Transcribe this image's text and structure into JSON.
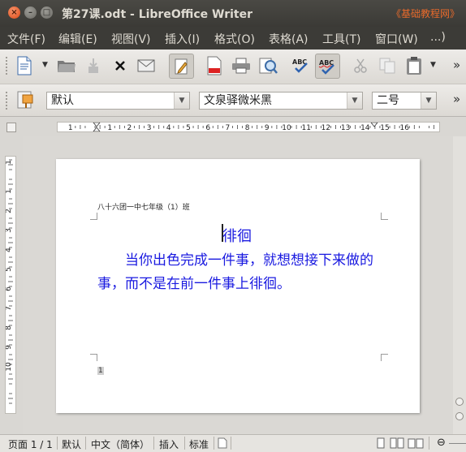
{
  "window": {
    "title": "第27课.odt - LibreOffice Writer",
    "watermark": "《基础教程网》",
    "close_glyph": "×",
    "min_glyph": "–",
    "max_glyph": "□"
  },
  "menu": [
    "文件(F)",
    "编辑(E)",
    "视图(V)",
    "插入(I)",
    "格式(O)",
    "表格(A)",
    "工具(T)",
    "窗口(W)",
    "...)"
  ],
  "toolbar": {
    "buttons": [
      "new-document",
      "open",
      "save",
      "close",
      "email",
      "edit-mode",
      "export-pdf",
      "print",
      "print-preview",
      "spellcheck",
      "autospellcheck",
      "cut",
      "copy",
      "paste"
    ],
    "overflow": "»"
  },
  "format_bar": {
    "paragraph_style": "默认",
    "font_name": "文泉驿微米黑",
    "font_size": "二号",
    "overflow": "»"
  },
  "ruler": {
    "h_labels": [
      "1",
      "1",
      "2",
      "3",
      "4",
      "5",
      "6",
      "7",
      "8",
      "9",
      "10",
      "11",
      "12",
      "13",
      "14",
      "15",
      "16"
    ],
    "v_labels": [
      "1",
      "1",
      "2",
      "3",
      "4",
      "5",
      "6",
      "7",
      "8",
      "9",
      "10"
    ]
  },
  "document": {
    "header_text": "八十六团一中七年级（1）班",
    "heading": "徘徊",
    "body": "当你出色完成一件事，就想想接下来做的事，而不是在前一件事上徘徊。",
    "footer_page_number": "1",
    "text_color": "#1a1ae0"
  },
  "status": {
    "page": "页面 1 / 1",
    "style": "默认",
    "language": "中文（简体）",
    "insert_mode": "插入",
    "selection_mode": "标准",
    "zoom_minus": "⊖"
  }
}
